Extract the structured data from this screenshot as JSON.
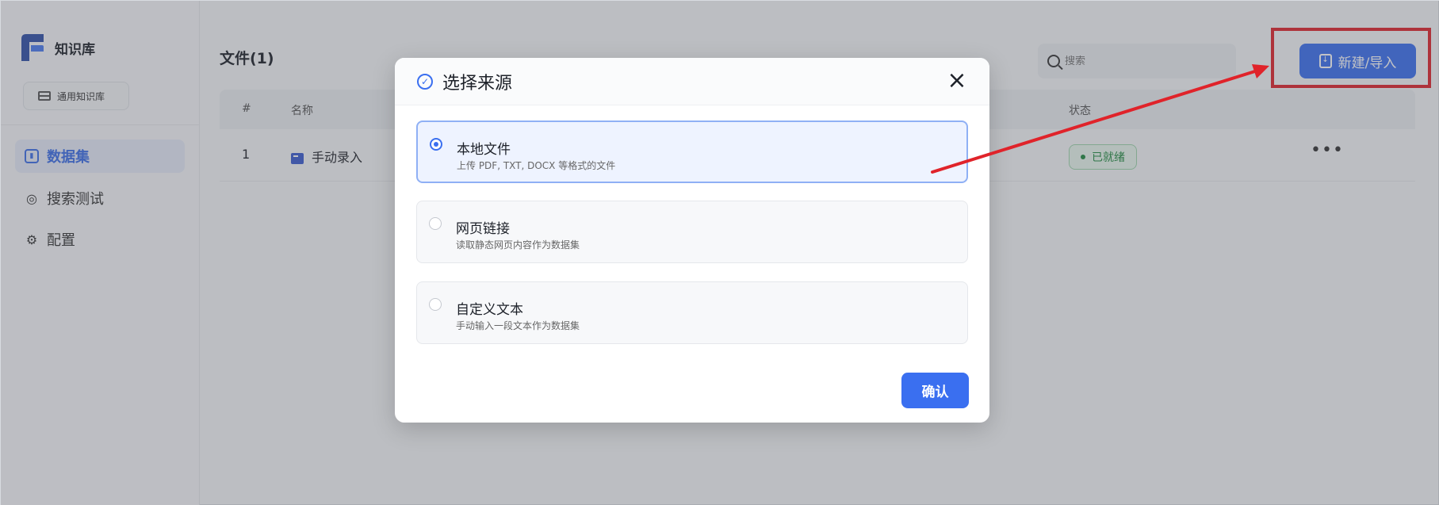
{
  "sidebar": {
    "app_title": "知识库",
    "kb_chip": "通用知识库",
    "nav": [
      {
        "label": "数据集",
        "active": true,
        "icon": "bar-chart-icon"
      },
      {
        "label": "搜索测试",
        "active": false,
        "icon": "target-icon"
      },
      {
        "label": "配置",
        "active": false,
        "icon": "gear-icon"
      }
    ]
  },
  "main": {
    "title": "文件(1)",
    "search_placeholder": "搜索",
    "new_button": "新建/导入",
    "table": {
      "headers": {
        "index": "#",
        "name": "名称",
        "status": "状态"
      },
      "rows": [
        {
          "index": "1",
          "name": "手动录入",
          "status": "已就绪"
        }
      ]
    }
  },
  "modal": {
    "title": "选择来源",
    "options": [
      {
        "title": "本地文件",
        "desc": "上传 PDF, TXT, DOCX 等格式的文件",
        "selected": true
      },
      {
        "title": "网页链接",
        "desc": "读取静态网页内容作为数据集",
        "selected": false
      },
      {
        "title": "自定义文本",
        "desc": "手动输入一段文本作为数据集",
        "selected": false
      }
    ],
    "confirm": "确认"
  },
  "colors": {
    "accent": "#3a6ff0",
    "annotation_red": "#e0232a",
    "status_green": "#1f8a3f"
  }
}
